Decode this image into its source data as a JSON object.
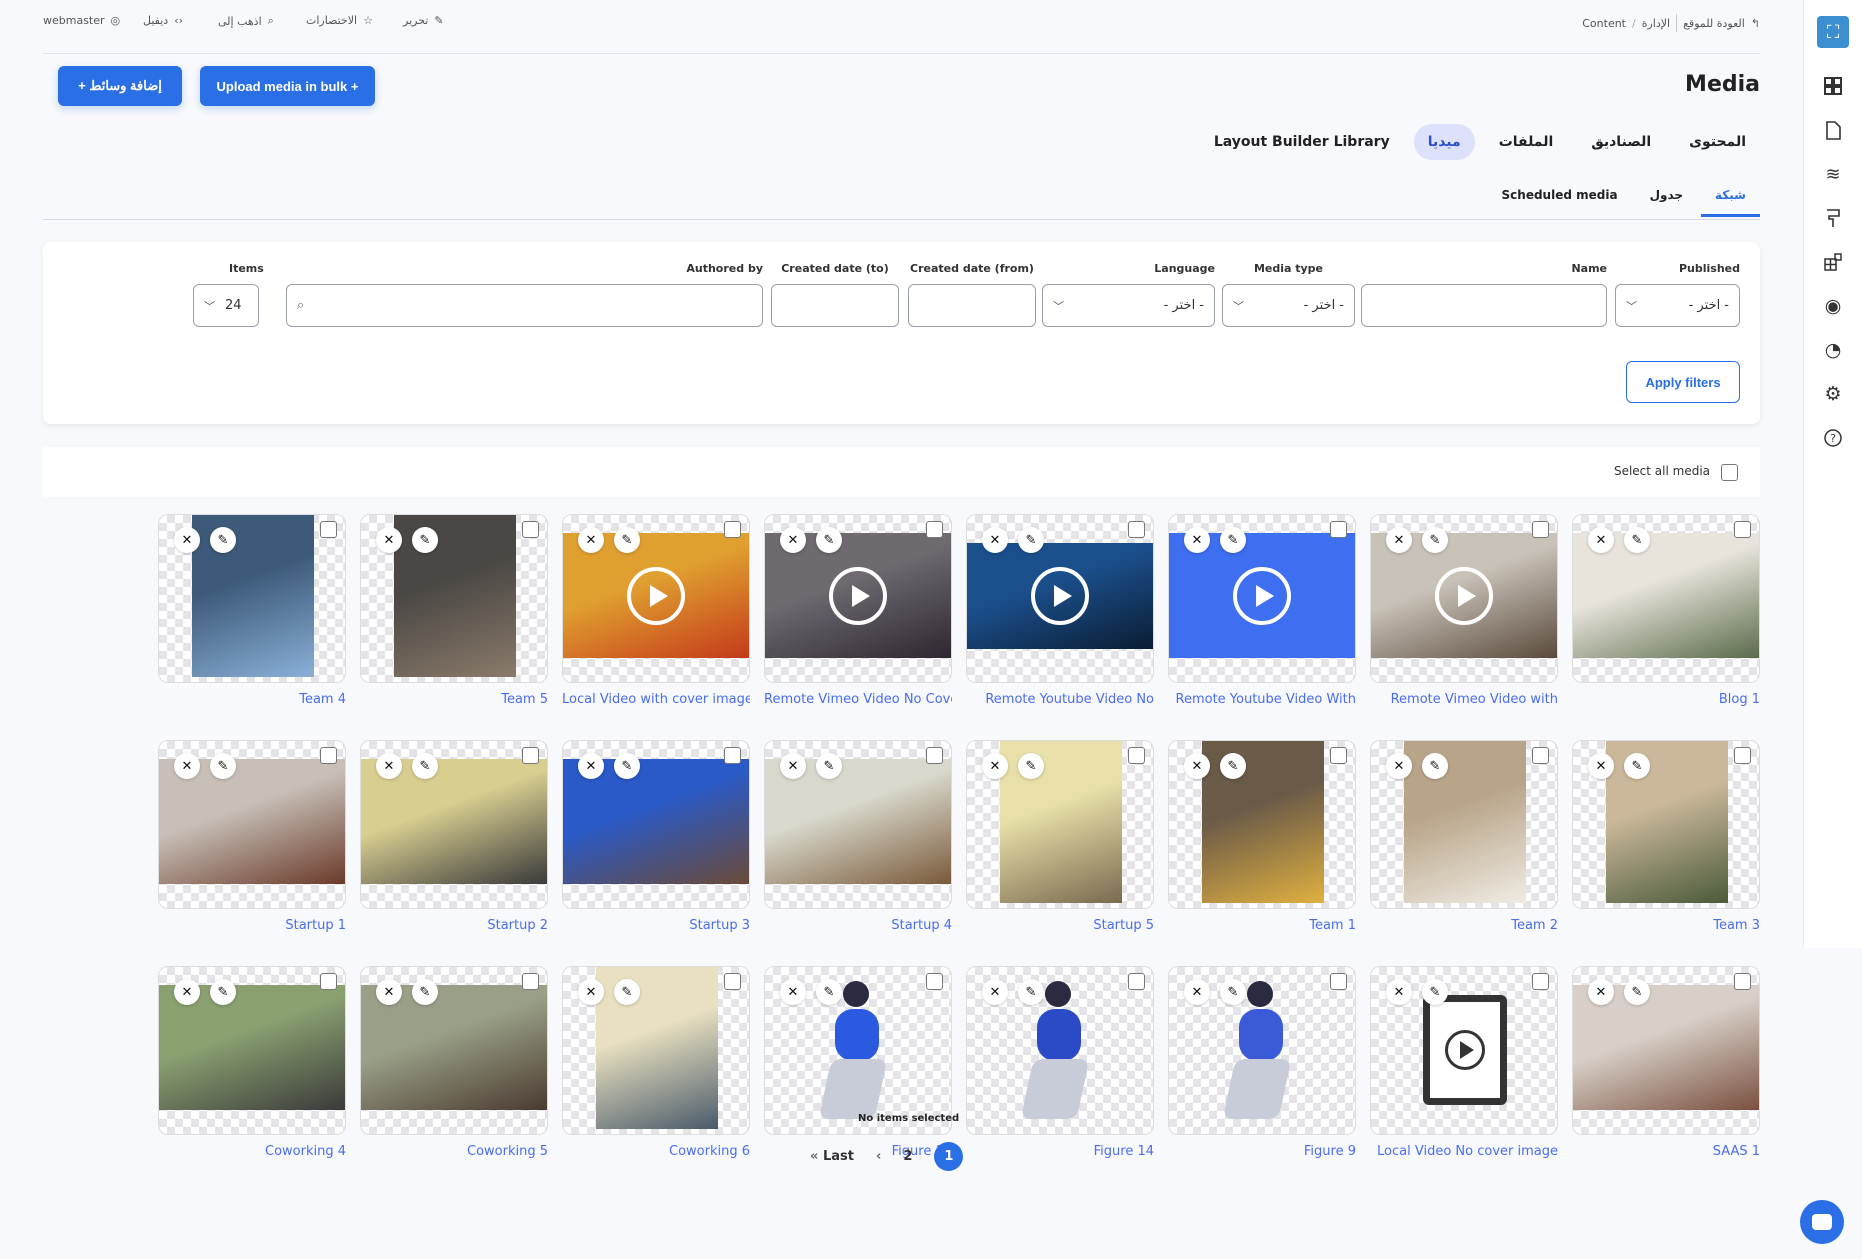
{
  "topbar": {
    "user": "webmaster",
    "devel": "ديفيل",
    "goto": "اذهب إلى",
    "shortcuts": "الاختصارات",
    "edit": "تحرير",
    "back_to_site": "العودة للموقع",
    "breadcrumb": [
      "الإدارة",
      "Content"
    ]
  },
  "actions": {
    "add_media": "+ إضافة وسائط",
    "bulk_upload": "Upload media in bulk +"
  },
  "page_title": "Media",
  "tabs": [
    {
      "label": "المحتوى",
      "active": false
    },
    {
      "label": "الصناديق",
      "active": false
    },
    {
      "label": "الملفات",
      "active": false
    },
    {
      "label": "ميديا",
      "active": true
    },
    {
      "label": "Layout Builder Library",
      "active": false
    }
  ],
  "subtabs": [
    {
      "label": "شبكة",
      "active": true
    },
    {
      "label": "جدول",
      "active": false
    },
    {
      "label": "Scheduled media",
      "active": false
    }
  ],
  "filters": {
    "published": {
      "label": "Published",
      "value": "- اختر -"
    },
    "name": {
      "label": "Name",
      "value": ""
    },
    "media_type": {
      "label": "Media type",
      "value": "- اختر -"
    },
    "language": {
      "label": "Language",
      "value": "- اختر -"
    },
    "created_from": {
      "label": "Created date (from)",
      "value": ""
    },
    "created_to": {
      "label": "Created date (to)",
      "value": ""
    },
    "authored_by": {
      "label": "Authored by",
      "value": ""
    },
    "items": {
      "label": "Items",
      "value": "24"
    },
    "apply": "Apply filters"
  },
  "select_all": "Select all media",
  "media": [
    {
      "name": "Blog 1",
      "orientation": "landscape",
      "video": false,
      "colors": [
        "#e8e4dc",
        "#5a6b4a"
      ]
    },
    {
      "name": "Remote Vimeo Video with",
      "orientation": "landscape",
      "video": true,
      "colors": [
        "#c9c2b8",
        "#5a4a3c"
      ]
    },
    {
      "name": "Remote Youtube Video With",
      "orientation": "landscape",
      "video": true,
      "colors": [
        "#3e6ff0",
        "#3e6ff0"
      ]
    },
    {
      "name": "Remote Youtube Video No",
      "orientation": "full",
      "video": true,
      "colors": [
        "#1b4f8c",
        "#0a1d33"
      ]
    },
    {
      "name": "Remote Vimeo Video No Cover",
      "orientation": "landscape",
      "video": true,
      "colors": [
        "#6e6a70",
        "#2e2630"
      ]
    },
    {
      "name": "Local Video with cover image",
      "orientation": "landscape",
      "video": true,
      "colors": [
        "#e0a030",
        "#c43a1a"
      ]
    },
    {
      "name": "Team 5",
      "orientation": "portrait",
      "video": false,
      "colors": [
        "#4a4744",
        "#8a7a6a"
      ]
    },
    {
      "name": "Team 4",
      "orientation": "portrait",
      "video": false,
      "colors": [
        "#3d5a7a",
        "#8ab0d8"
      ]
    },
    {
      "name": "Team 3",
      "orientation": "portrait",
      "video": false,
      "colors": [
        "#cbb89a",
        "#4a5a3a"
      ]
    },
    {
      "name": "Team 2",
      "orientation": "portrait",
      "video": false,
      "colors": [
        "#b8a488",
        "#f0ece4"
      ]
    },
    {
      "name": "Team 1",
      "orientation": "portrait",
      "video": false,
      "colors": [
        "#6a5a48",
        "#e0b040"
      ]
    },
    {
      "name": "Startup 5",
      "orientation": "portrait",
      "video": false,
      "colors": [
        "#e8e0a8",
        "#7a6a50"
      ]
    },
    {
      "name": "Startup 4",
      "orientation": "landscape",
      "video": false,
      "colors": [
        "#d8d8cc",
        "#7a5a3a"
      ]
    },
    {
      "name": "Startup 3",
      "orientation": "landscape",
      "video": false,
      "colors": [
        "#2a5ac8",
        "#6a4a38"
      ]
    },
    {
      "name": "Startup 2",
      "orientation": "landscape",
      "video": false,
      "colors": [
        "#d8ce90",
        "#3a3a3a"
      ]
    },
    {
      "name": "Startup 1",
      "orientation": "landscape",
      "video": false,
      "colors": [
        "#c8c0b8",
        "#6a3a2a"
      ]
    },
    {
      "name": "SAAS 1",
      "orientation": "landscape",
      "video": false,
      "colors": [
        "#d8d0c8",
        "#7a5040"
      ]
    },
    {
      "name": "Local Video No cover image",
      "orientation": "file",
      "video": false,
      "colors": [
        "#ffffff",
        "#ffffff"
      ]
    },
    {
      "name": "Figure 9",
      "orientation": "figure",
      "video": false,
      "colors": [
        "#3a5ad8",
        "#c8ccd8"
      ]
    },
    {
      "name": "Figure 14",
      "orientation": "figure",
      "video": false,
      "colors": [
        "#2a4ac8",
        "#c8ccd8"
      ]
    },
    {
      "name": "Figure 12",
      "orientation": "figure",
      "video": false,
      "colors": [
        "#2a5ae0",
        "#c8ccd8"
      ]
    },
    {
      "name": "Coworking 6",
      "orientation": "portrait",
      "video": false,
      "colors": [
        "#e8e0c0",
        "#4a5a6a"
      ]
    },
    {
      "name": "Coworking 5",
      "orientation": "landscape",
      "video": false,
      "colors": [
        "#9aa088",
        "#4a3a30"
      ]
    },
    {
      "name": "Coworking 4",
      "orientation": "landscape",
      "video": false,
      "colors": [
        "#8aa070",
        "#3a3a3a"
      ]
    }
  ],
  "selection_status": "No items selected",
  "pager": {
    "last": "Last",
    "pages": [
      "2",
      "1"
    ],
    "current": "1"
  },
  "accent": "#2a6fe6"
}
